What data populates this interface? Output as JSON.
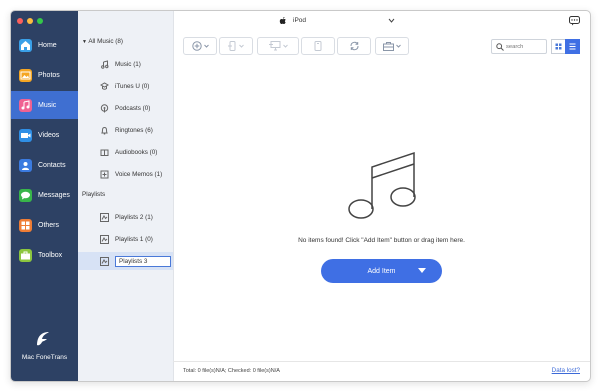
{
  "device": {
    "name": "iPod"
  },
  "nav": [
    {
      "label": "Home",
      "icon": "home-icon",
      "color": "#3aa0e8",
      "active": false
    },
    {
      "label": "Photos",
      "icon": "photos-icon",
      "color": "#f5a623",
      "active": false
    },
    {
      "label": "Music",
      "icon": "music-icon",
      "color": "#f06292",
      "active": true
    },
    {
      "label": "Videos",
      "icon": "videos-icon",
      "color": "#2f8fe6",
      "active": false
    },
    {
      "label": "Contacts",
      "icon": "contacts-icon",
      "color": "#3b7be0",
      "active": false
    },
    {
      "label": "Messages",
      "icon": "messages-icon",
      "color": "#39b54a",
      "active": false
    },
    {
      "label": "Others",
      "icon": "others-icon",
      "color": "#ef7d35",
      "active": false
    },
    {
      "label": "Toolbox",
      "icon": "toolbox-icon",
      "color": "#8cc63f",
      "active": false
    }
  ],
  "brand": {
    "name": "Mac FoneTrans"
  },
  "tree": {
    "all_music": "All Music (8)",
    "items": [
      {
        "label": "Music (1)",
        "icon": "music-note-icon"
      },
      {
        "label": "iTunes U (0)",
        "icon": "itunes-u-icon"
      },
      {
        "label": "Podcasts (0)",
        "icon": "podcast-icon"
      },
      {
        "label": "Ringtones (6)",
        "icon": "bell-icon"
      },
      {
        "label": "Audiobooks (0)",
        "icon": "audiobook-icon"
      },
      {
        "label": "Voice Memos (1)",
        "icon": "voice-memo-icon"
      }
    ],
    "playlists_header": "Playlists",
    "playlists": [
      {
        "label": "Playlists 2 (1)",
        "selected": false
      },
      {
        "label": "Playlists 1 (0)",
        "selected": false
      },
      {
        "label": "Playlists 3",
        "selected": true
      }
    ]
  },
  "search": {
    "placeholder": "search"
  },
  "empty": {
    "message": "No items found! Click \"Add Item\" button or drag item here.",
    "add_label": "Add Item"
  },
  "status": {
    "summary": "Total: 0 file(s)N/A; Checked: 0 file(s)N/A",
    "data_lost": "Data lost?"
  },
  "colors": {
    "accent": "#3f6fe4",
    "sidebar": "#2d4164",
    "active": "#3f6fd1"
  }
}
